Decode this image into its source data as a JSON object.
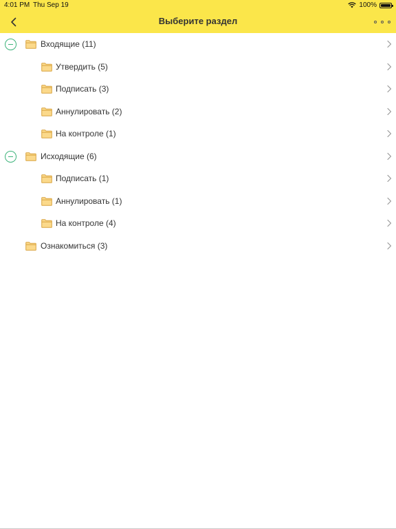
{
  "status_bar": {
    "time": "4:01 PM",
    "date": "Thu Sep 19",
    "battery_text": "100%",
    "battery_level": 1.0,
    "wifi_icon": "wifi-icon"
  },
  "header": {
    "title": "Выберите раздел",
    "back_icon": "chevron-left-icon",
    "more_icon": "more-dots-icon"
  },
  "colors": {
    "accent": "#fbe64a",
    "collapse": "#3cb37a",
    "folder_fill": "#fbd98b",
    "folder_stroke": "#d9a441"
  },
  "tree": [
    {
      "label": "Входящие (11)",
      "level": 0,
      "expanded": true
    },
    {
      "label": "Утвердить (5)",
      "level": 1
    },
    {
      "label": "Подписать (3)",
      "level": 1
    },
    {
      "label": "Аннулировать (2)",
      "level": 1
    },
    {
      "label": "На контроле (1)",
      "level": 1
    },
    {
      "label": "Исходящие (6)",
      "level": 0,
      "expanded": true
    },
    {
      "label": "Подписать (1)",
      "level": 1
    },
    {
      "label": "Аннулировать (1)",
      "level": 1
    },
    {
      "label": "На контроле (4)",
      "level": 1
    },
    {
      "label": "Ознакомиться (3)",
      "level": 0
    }
  ]
}
